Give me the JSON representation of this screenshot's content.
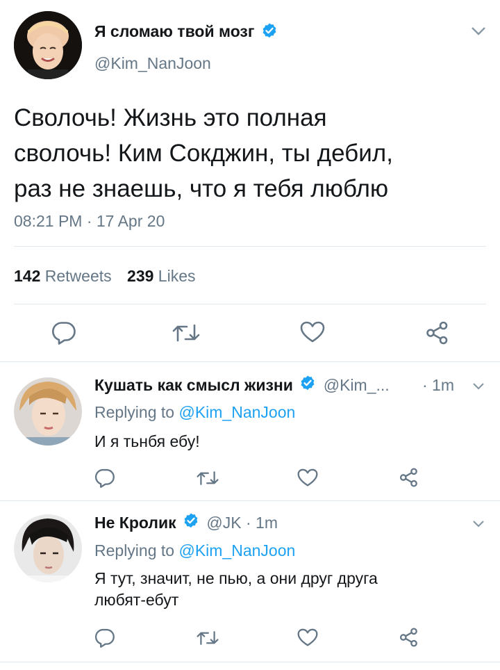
{
  "colors": {
    "text": "#14171a",
    "muted": "#657786",
    "link": "#1da1f2",
    "verified": "#1da1f2",
    "divider": "#e1e8ed"
  },
  "main_tweet": {
    "display_name": "Я сломаю твой мозг",
    "handle": "@Kim_NanJoon",
    "verified": true,
    "text_lines": [
      "Сволочь! Жизнь это полная",
      "сволочь! Ким Сокджин, ты дебил,",
      "раз не знаешь, что я тебя люблю"
    ],
    "timestamp": "08:21 PM · 17 Apr 20",
    "stats": {
      "retweets_count": "142",
      "retweets_label": "Retweets",
      "likes_count": "239",
      "likes_label": "Likes"
    },
    "actions": [
      "reply-icon",
      "retweet-icon",
      "like-icon",
      "share-icon"
    ]
  },
  "replies": [
    {
      "display_name": "Кушать как смысл жизни",
      "verified": true,
      "handle": "@Kim_...",
      "time": "· 1m",
      "replying_prefix": "Replying to",
      "replying_to": "@Kim_NanJoon",
      "text_lines": [
        "И я тьнбя ебу!"
      ]
    },
    {
      "display_name": "Не Кролик",
      "verified": true,
      "handle": "@JK",
      "time": "· 1m",
      "replying_prefix": "Replying to",
      "replying_to": "@Kim_NanJoon",
      "text_lines": [
        "Я тут, значит, не пью, а они друг друга",
        "любят-ебут"
      ]
    }
  ]
}
